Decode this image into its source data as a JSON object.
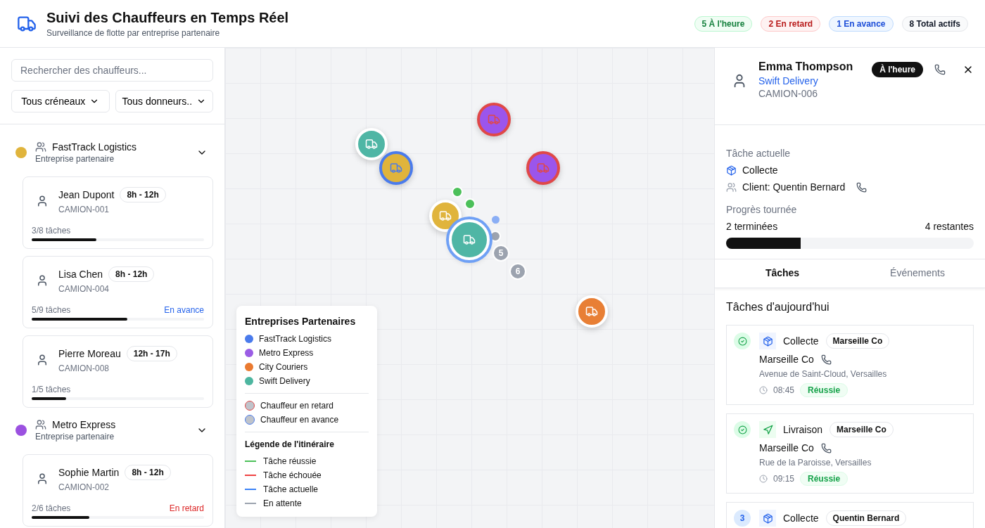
{
  "header": {
    "title": "Suivi des Chauffeurs en Temps Réel",
    "subtitle": "Surveillance de flotte par entreprise partenaire",
    "stats": [
      {
        "label": "5 À l'heure",
        "kind": "on_time"
      },
      {
        "label": "2 En retard",
        "kind": "late"
      },
      {
        "label": "1 En avance",
        "kind": "early"
      },
      {
        "label": "8 Total actifs",
        "kind": "total"
      }
    ]
  },
  "sidebar": {
    "search": {
      "placeholder": "Rechercher des chauffeurs..."
    },
    "filters": [
      "Tous créneaux",
      "Tous donneurs.."
    ],
    "groups": [
      {
        "name": "FastTrack Logistics",
        "subtitle": "Entreprise partenaire",
        "color": "#e0b43c",
        "expanded": true,
        "drivers": [
          {
            "name": "Jean Dupont",
            "slot": "8h - 12h",
            "truck": "CAMION-001",
            "progress": "3/8 tâches",
            "level": 0.375
          },
          {
            "name": "Lisa Chen",
            "slot": "8h - 12h",
            "truck": "CAMION-004",
            "progress": "5/9 tâches",
            "level": 0.556,
            "kind": "early",
            "status_label": "En avance"
          },
          {
            "name": "Pierre Moreau",
            "slot": "12h - 17h",
            "truck": "CAMION-008",
            "progress": "1/5 tâches",
            "level": 0.2
          }
        ]
      },
      {
        "name": "Metro Express",
        "subtitle": "Entreprise partenaire",
        "color": "#9b51e0",
        "expanded": true,
        "drivers": [
          {
            "name": "Sophie Martin",
            "slot": "8h - 12h",
            "truck": "CAMION-002",
            "progress": "2/6 tâches",
            "level": 0.333,
            "kind": "late",
            "status_label": "En retard"
          }
        ]
      }
    ]
  },
  "map": {
    "markers": [
      {
        "color": "#4fb6a5",
        "kind": "on_time",
        "selected": false
      },
      {
        "color": "#e0b43c",
        "kind": "early",
        "selected": false
      },
      {
        "color": "#9b55ec",
        "kind": "late",
        "selected": false
      },
      {
        "color": "#9b55ec",
        "kind": "late",
        "selected": false
      },
      {
        "color": "#e0b43c",
        "kind": "on_time",
        "selected": false
      },
      {
        "color": "#4fb6a5",
        "kind": "on_time",
        "selected": true
      },
      {
        "color": "#e87f35",
        "kind": "on_time",
        "selected": false
      }
    ],
    "stops": [
      {
        "kind": "success"
      },
      {
        "kind": "success"
      },
      {
        "kind": "current"
      },
      {
        "kind": "pending"
      },
      {
        "kind": "pending",
        "label": "5"
      },
      {
        "kind": "pending",
        "label": "6"
      }
    ],
    "legend": {
      "title": "Entreprises Partenaires",
      "partners": [
        {
          "name": "FastTrack Logistics",
          "color": "#4a7bec"
        },
        {
          "name": "Metro Express",
          "color": "#9b5de5"
        },
        {
          "name": "City Couriers",
          "color": "#ea7a30"
        },
        {
          "name": "Swift Delivery",
          "color": "#4db6a0"
        }
      ],
      "driver_states": [
        {
          "label": "Chauffeur en retard",
          "kind": "late"
        },
        {
          "label": "Chauffeur en avance",
          "kind": "early"
        }
      ],
      "route_title": "Légende de l'itinéraire",
      "route_items": [
        {
          "label": "Tâche réussie",
          "color": "#4cc05a"
        },
        {
          "label": "Tâche échouée",
          "color": "#ef4444"
        },
        {
          "label": "Tâche actuelle",
          "color": "#3b82f6"
        },
        {
          "label": "En attente",
          "color": "#9ca3af"
        }
      ]
    }
  },
  "detail": {
    "name": "Emma Thompson",
    "company": "Swift Delivery",
    "truck": "CAMION-006",
    "badge": "À l'heure",
    "current_task_label": "Tâche actuelle",
    "task_type": "Collecte",
    "client": "Client: Quentin Bernard",
    "progress_label": "Progrès tournée",
    "done": "2 terminées",
    "remaining": "4 restantes",
    "level": 0.3,
    "tabs": [
      {
        "label": "Tâches",
        "selected": true
      },
      {
        "label": "Événements",
        "selected": false
      }
    ],
    "tasks_title": "Tâches d'aujourd'hui",
    "tasks": [
      {
        "completed": true,
        "kind": "pickup",
        "type": "Collecte",
        "tag": "Marseille Co",
        "name": "Marseille Co",
        "address": "Avenue de Saint-Cloud, Versailles",
        "time": "08:45",
        "result": "Réussie"
      },
      {
        "completed": true,
        "kind": "delivery",
        "type": "Livraison",
        "tag": "Marseille Co",
        "name": "Marseille Co",
        "address": "Rue de la Paroisse, Versailles",
        "time": "09:15",
        "result": "Réussie"
      },
      {
        "completed": false,
        "number": "3",
        "kind": "pickup",
        "type": "Collecte",
        "tag": "Quentin Bernard"
      }
    ]
  }
}
